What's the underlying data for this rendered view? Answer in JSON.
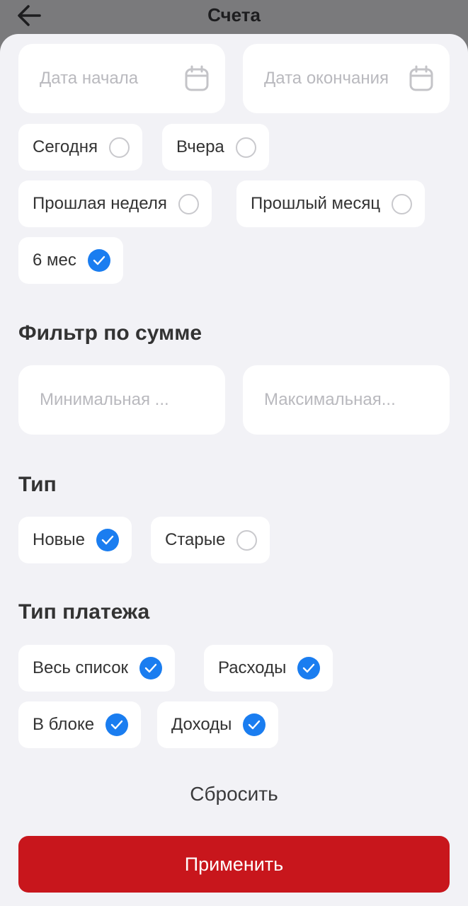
{
  "header": {
    "title": "Счета"
  },
  "date": {
    "start_placeholder": "Дата начала",
    "end_placeholder": "Дата окончания",
    "options": [
      {
        "label": "Сегодня",
        "checked": false
      },
      {
        "label": "Вчера",
        "checked": false
      },
      {
        "label": "Прошлая неделя",
        "checked": false
      },
      {
        "label": "Прошлый месяц",
        "checked": false
      },
      {
        "label": "6 мес",
        "checked": true
      }
    ]
  },
  "amount": {
    "title": "Фильтр по сумме",
    "min_placeholder": "Минимальная ...",
    "max_placeholder": "Максимальная..."
  },
  "type": {
    "title": "Тип",
    "options": [
      {
        "label": "Новые",
        "checked": true
      },
      {
        "label": "Старые",
        "checked": false
      }
    ]
  },
  "payment": {
    "title": "Тип платежа",
    "options": [
      {
        "label": "Весь список",
        "checked": true
      },
      {
        "label": "Расходы",
        "checked": true
      },
      {
        "label": "В блоке",
        "checked": true
      },
      {
        "label": "Доходы",
        "checked": true
      }
    ]
  },
  "actions": {
    "reset_label": "Сбросить",
    "apply_label": "Применить"
  },
  "colors": {
    "accent": "#1a7df0",
    "primary_button": "#c8161c",
    "sheet_bg": "#f2f2f6"
  }
}
